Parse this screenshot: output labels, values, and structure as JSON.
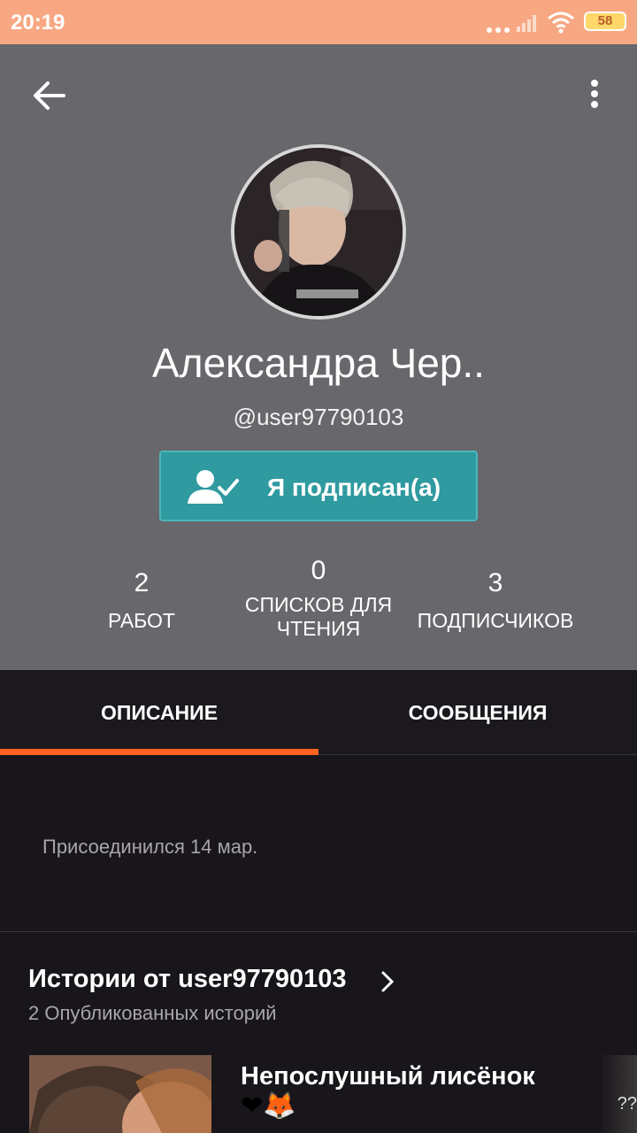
{
  "status_bar": {
    "time": "20:19",
    "battery": "58",
    "signal_icon": "signal-bars-icon",
    "wifi_icon": "wifi-icon"
  },
  "header": {
    "back_icon": "arrow-left-icon",
    "menu_icon": "more-vertical-icon"
  },
  "profile": {
    "name": "Александра Чер..",
    "username": "@user97790103",
    "follow_button_label": "Я подписан(а)",
    "follow_icon": "user-check-icon"
  },
  "stats": {
    "works": {
      "value": "2",
      "label": "РАБОТ"
    },
    "reading_lists": {
      "value": "0",
      "label_line1": "СПИСКОВ ДЛЯ",
      "label_line2": "ЧТЕНИЯ"
    },
    "followers": {
      "value": "3",
      "label": "ПОДПИСЧИКОВ"
    }
  },
  "tabs": [
    {
      "label": "ОПИСАНИЕ",
      "active": true
    },
    {
      "label": "СООБЩЕНИЯ",
      "active": false
    }
  ],
  "description": {
    "joined": "Присоединился 14 мар."
  },
  "stories": {
    "title": "Истории от user97790103",
    "count": "2 Опубликованных историй",
    "items": [
      {
        "title": "Непослушный лисёнок",
        "emoji": "❤🦊"
      }
    ],
    "next_partial": "??"
  },
  "colors": {
    "accent": "#ff6122",
    "status_bar": "#f7a882",
    "header_bg": "#68676b",
    "follow_button": "#2f9aa0",
    "page_bg": "#18161a"
  }
}
